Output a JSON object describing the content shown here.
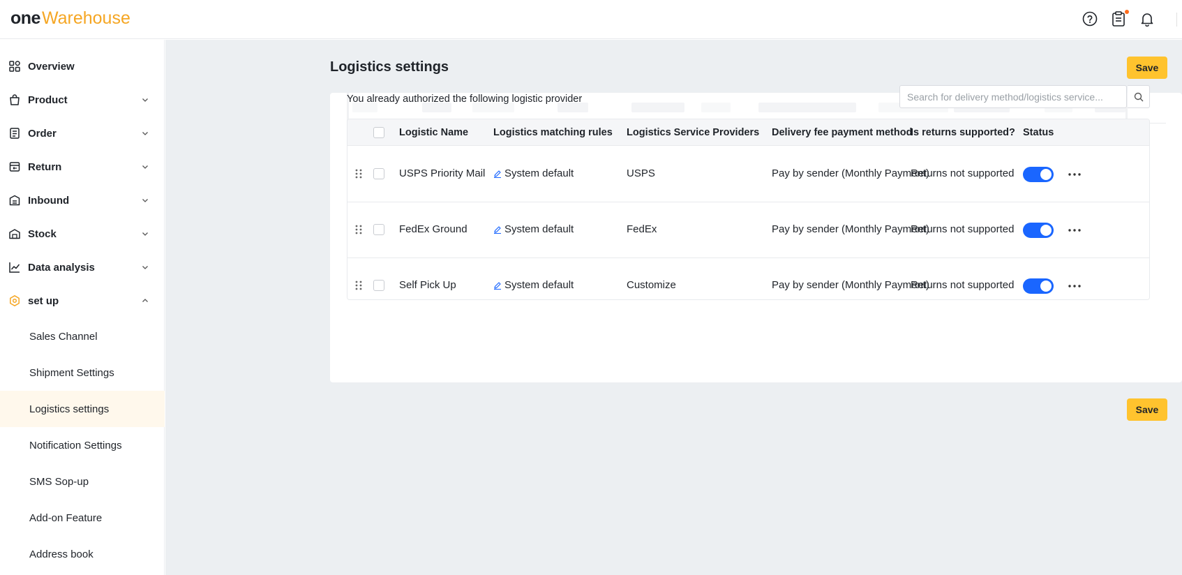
{
  "header": {
    "logo_one": "one",
    "logo_rest": "Warehouse",
    "icons": [
      "help-circle-icon",
      "clipboard-icon",
      "bell-icon"
    ]
  },
  "sidebar": {
    "items": [
      {
        "label": "Overview",
        "icon": "overview-grid-icon"
      },
      {
        "label": "Product",
        "icon": "product-bag-icon",
        "expanded": false
      },
      {
        "label": "Order",
        "icon": "order-list-icon",
        "expanded": false
      },
      {
        "label": "Return",
        "icon": "return-box-icon",
        "expanded": false
      },
      {
        "label": "Inbound",
        "icon": "inbound-box-icon",
        "expanded": false
      },
      {
        "label": "Stock",
        "icon": "stock-warehouse-icon",
        "expanded": false
      },
      {
        "label": "Data analysis",
        "icon": "chart-line-icon",
        "expanded": false
      },
      {
        "label": "set up",
        "icon": "setup-hexagon-icon",
        "expanded": true
      }
    ],
    "subitems": [
      {
        "label": "Sales Channel"
      },
      {
        "label": "Shipment Settings"
      },
      {
        "label": "Logistics settings",
        "active": true
      },
      {
        "label": "Notification Settings"
      },
      {
        "label": "SMS Sop-up"
      },
      {
        "label": "Add-on Feature"
      },
      {
        "label": "Address book"
      }
    ]
  },
  "main": {
    "title": "Logistics settings",
    "save_label": "Save",
    "save_label_bottom": "Save",
    "authorized_text": "You already authorized the following logistic provider",
    "search_placeholder": "Search for delivery method/logistics service...",
    "columns": [
      "Logistic Name",
      "Logistics matching rules",
      "Logistics Service Providers",
      "Delivery fee payment method",
      "Is returns supported?",
      "Status"
    ],
    "rows": [
      {
        "name": "USPS Priority Mail",
        "rule": "System default",
        "provider": "USPS",
        "payment": "Pay by sender (Monthly Payment)",
        "returns": "Returns not supported",
        "status_on": true
      },
      {
        "name": "FedEx Ground",
        "rule": "System default",
        "provider": "FedEx",
        "payment": "Pay by sender (Monthly Payment)",
        "returns": "Returns not supported",
        "status_on": true
      },
      {
        "name": "Self Pick Up",
        "rule": "System default",
        "provider": "Customize",
        "payment": "Pay by sender (Monthly Payment)",
        "returns": "Returns not supported",
        "status_on": true
      }
    ]
  },
  "colors": {
    "brand_orange": "#f5a623",
    "save_yellow": "#ffc32e",
    "toggle_blue": "#1a66ff",
    "edit_blue": "#1a66ff",
    "main_bg": "#eceff2"
  }
}
